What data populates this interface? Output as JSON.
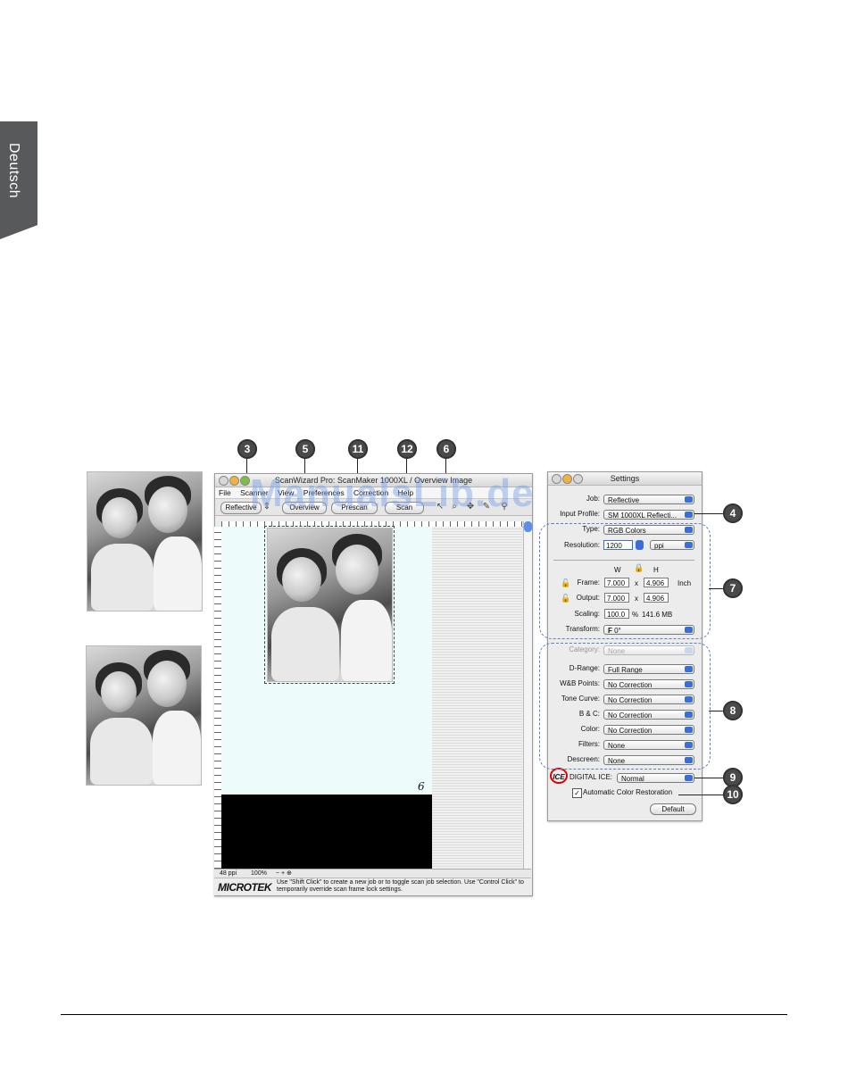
{
  "side_tab": {
    "label": "Deutsch"
  },
  "callouts": [
    "3",
    "5",
    "11",
    "12",
    "6",
    "4",
    "7",
    "8",
    "9",
    "10"
  ],
  "main_window": {
    "title": "ScanWizard Pro: ScanMaker 1000XL / Overview Image",
    "menu": [
      "File",
      "Scanner",
      "View",
      "Preferences",
      "Correction",
      "Help"
    ],
    "toolbar": {
      "mode": "Reflective",
      "overview": "Overview",
      "prescan": "Prescan",
      "scan": "Scan"
    },
    "scan_note": "6",
    "status": {
      "res": "48 ppi",
      "zoom": "100%"
    },
    "logo": "MICROTEK",
    "message": "Use \"Shift Click\" to create a new job or to toggle scan job selection. Use \"Control Click\" to temporarily override scan frame lock settings."
  },
  "settings": {
    "title": "Settings",
    "job_label": "Job:",
    "job_value": "Reflective",
    "input_profile_label": "Input Profile:",
    "input_profile_value": "SM 1000XL Reflecti...",
    "type_label": "Type:",
    "type_value": "RGB Colors",
    "resolution_label": "Resolution:",
    "resolution_value": "1200",
    "resolution_unit": "ppi",
    "col_w": "W",
    "col_h": "H",
    "frame_label": "Frame:",
    "frame_w": "7.000",
    "frame_h": "4.906",
    "output_label": "Output:",
    "output_w": "7.000",
    "output_h": "4.906",
    "times": "x",
    "unit": "Inch",
    "scaling_label": "Scaling:",
    "scaling_value": "100.0",
    "percent": "%",
    "file_size": "141.6 MB",
    "transform_label": "Transform:",
    "transform_value": "0°",
    "category_label": "Category:",
    "category_value": "None",
    "drange_label": "D-Range:",
    "drange_value": "Full Range",
    "wb_label": "W&B Points:",
    "wb_value": "No Correction",
    "tone_label": "Tone Curve:",
    "tone_value": "No Correction",
    "bc_label": "B & C:",
    "bc_value": "No Correction",
    "color_label": "Color:",
    "color_value": "No Correction",
    "filters_label": "Filters:",
    "filters_value": "None",
    "descreen_label": "Descreen:",
    "descreen_value": "None",
    "ice_badge": "ICE",
    "ice_label": "DIGITAL ICE:",
    "ice_value": "Normal",
    "auto_color_label": "Automatic Color Restoration",
    "auto_color_checked": true,
    "default_button": "Default"
  },
  "watermark": "ManualsLib.de"
}
